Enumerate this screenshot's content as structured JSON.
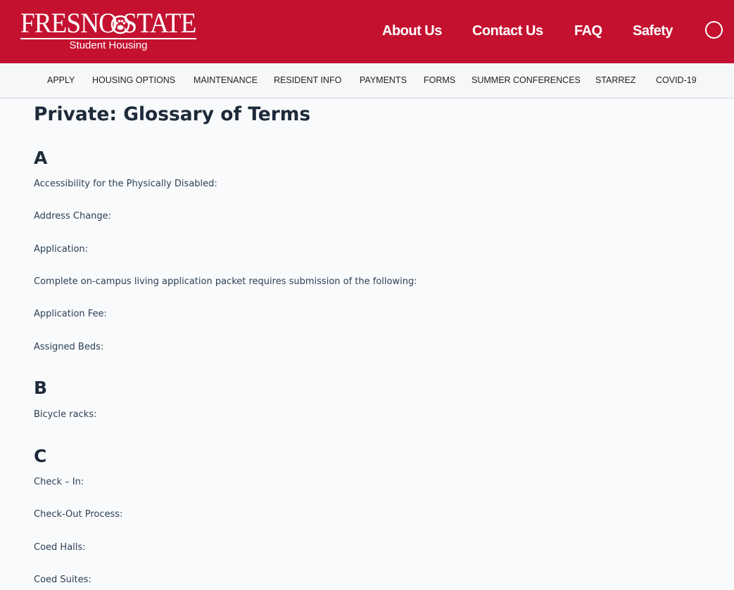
{
  "header": {
    "logo": {
      "wordmark": "FRESNO STATE",
      "subtitle": "Student Housing"
    },
    "nav": [
      "About Us",
      "Contact Us",
      "FAQ",
      "Safety"
    ],
    "brand_color": "#c41130"
  },
  "subnav": [
    "APPLY",
    "HOUSING OPTIONS",
    "MAINTENANCE",
    "RESIDENT INFO",
    "PAYMENTS",
    "FORMS",
    "SUMMER CONFERENCES",
    "STARREZ",
    "COVID-19"
  ],
  "page": {
    "title": "Private: Glossary of Terms",
    "sections": [
      {
        "letter": "A",
        "terms": [
          "Accessibility for the Physically Disabled:",
          "Address Change:",
          "Application:",
          "Complete on-campus living application packet requires submission of the following:",
          "Application Fee:",
          "Assigned Beds:"
        ]
      },
      {
        "letter": "B",
        "terms": [
          "Bicycle racks:"
        ]
      },
      {
        "letter": "C",
        "terms": [
          "Check – In:",
          "Check-Out Process:",
          "Coed Halls:",
          "Coed Suites:"
        ]
      }
    ]
  }
}
